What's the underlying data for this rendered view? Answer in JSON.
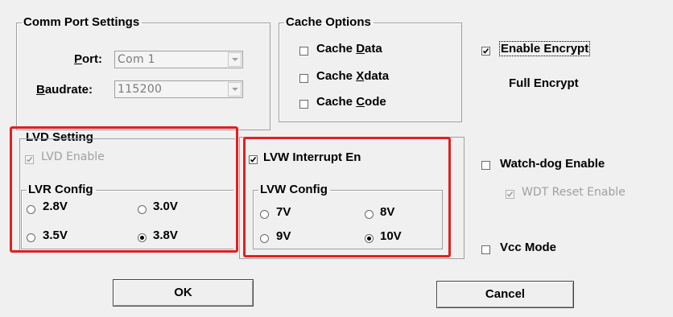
{
  "comm_port": {
    "title": "Comm Port Settings",
    "port_label_pre": "",
    "port_label_u": "P",
    "port_label_post": "ort:",
    "port_value": "Com 1",
    "baud_label_u": "B",
    "baud_label_post": "audrate:",
    "baud_value": "115200"
  },
  "cache": {
    "title": "Cache Options",
    "data_pre": "Cache ",
    "data_u": "D",
    "data_post": "ata",
    "xdata_pre": "Cache ",
    "xdata_u": "X",
    "xdata_post": "data",
    "code_pre": "Cache ",
    "code_u": "C",
    "code_post": "ode"
  },
  "encrypt": {
    "enable_label": "Enable Encrypt",
    "enable_checked": true,
    "mode_text": "Full Encrypt"
  },
  "lvd": {
    "title": "LVD Setting",
    "enable_label": "LVD Enable",
    "enable_checked": true,
    "lvr_title": "LVR Config",
    "options": [
      "2.8V",
      "3.0V",
      "3.5V",
      "3.8V"
    ],
    "selected": "3.8V"
  },
  "lvw": {
    "interrupt_label": "LVW Interrupt En",
    "interrupt_checked": true,
    "config_title": "LVW Config",
    "options": [
      "7V",
      "8V",
      "9V",
      "10V"
    ],
    "selected": "10V"
  },
  "watchdog": {
    "enable_label": "Watch-dog Enable",
    "enable_checked": false,
    "wdt_reset_label": "WDT Reset Enable",
    "wdt_reset_checked": true
  },
  "vcc": {
    "label": "Vcc Mode",
    "checked": false
  },
  "buttons": {
    "ok": "OK",
    "cancel": "Cancel"
  },
  "colors": {
    "highlight": "#e02020",
    "disabled": "#a0a0a0",
    "background": "#f0f0f0"
  }
}
